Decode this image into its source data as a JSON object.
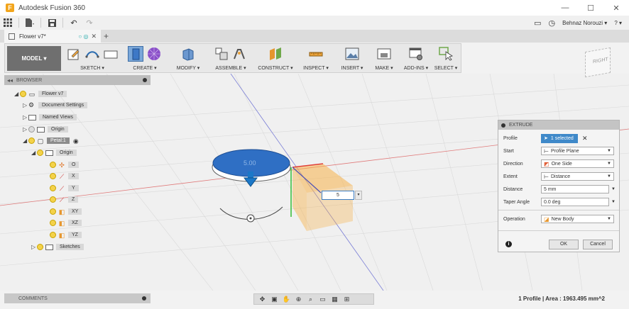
{
  "window": {
    "title": "Autodesk Fusion 360",
    "minimize_glyph": "—",
    "maximize_glyph": "☐",
    "close_glyph": "✕"
  },
  "quick_access": {
    "user_name": "Behnaz Norouzi ▾",
    "help_label": "? ▾"
  },
  "document_tab": {
    "name": "Flower v7*",
    "status_glyph": "○ ◎",
    "close_glyph": "✕",
    "new_tab_glyph": "+"
  },
  "ribbon": {
    "workspace_label": "MODEL ▾",
    "groups": [
      {
        "label": "SKETCH ▾"
      },
      {
        "label": "CREATE ▾"
      },
      {
        "label": "MODIFY ▾"
      },
      {
        "label": "ASSEMBLE ▾"
      },
      {
        "label": "CONSTRUCT ▾"
      },
      {
        "label": "INSPECT ▾"
      },
      {
        "label": "INSERT ▾"
      },
      {
        "label": "MAKE ▾"
      },
      {
        "label": "ADD-INS ▾"
      },
      {
        "label": "SELECT ▾"
      }
    ]
  },
  "viewcube": {
    "face_label": "RIGHT"
  },
  "browser": {
    "header": "BROWSER",
    "items": [
      {
        "label": "Flower v7"
      },
      {
        "label": "Document Settings"
      },
      {
        "label": "Named Views"
      },
      {
        "label": "Origin"
      },
      {
        "label": "Petal:1"
      },
      {
        "label": "Origin"
      },
      {
        "label": "O"
      },
      {
        "label": "X"
      },
      {
        "label": "Y"
      },
      {
        "label": "Z"
      },
      {
        "label": "XY"
      },
      {
        "label": "XZ"
      },
      {
        "label": "YZ"
      },
      {
        "label": "Sketches"
      }
    ]
  },
  "viewport": {
    "dimension_label": "5.00",
    "distance_input_value": "5"
  },
  "extrude": {
    "title": "EXTRUDE",
    "rows": [
      {
        "label": "Profile",
        "value": "1 selected"
      },
      {
        "label": "Start",
        "value": "Profile Plane"
      },
      {
        "label": "Direction",
        "value": "One Side"
      },
      {
        "label": "Extent",
        "value": "Distance"
      },
      {
        "label": "Distance",
        "value": "5 mm"
      },
      {
        "label": "Taper Angle",
        "value": "0.0 deg"
      },
      {
        "label": "Operation",
        "value": "New Body"
      }
    ],
    "ok_label": "OK",
    "cancel_label": "Cancel"
  },
  "comments": {
    "header": "COMMENTS"
  },
  "status": {
    "text": "1 Profile | Area : 1963.495 mm^2"
  },
  "colors": {
    "accent_blue": "#3f89c9",
    "sketch_fill": "#2f6fc4",
    "extrude_preview": "#f7b24a"
  }
}
